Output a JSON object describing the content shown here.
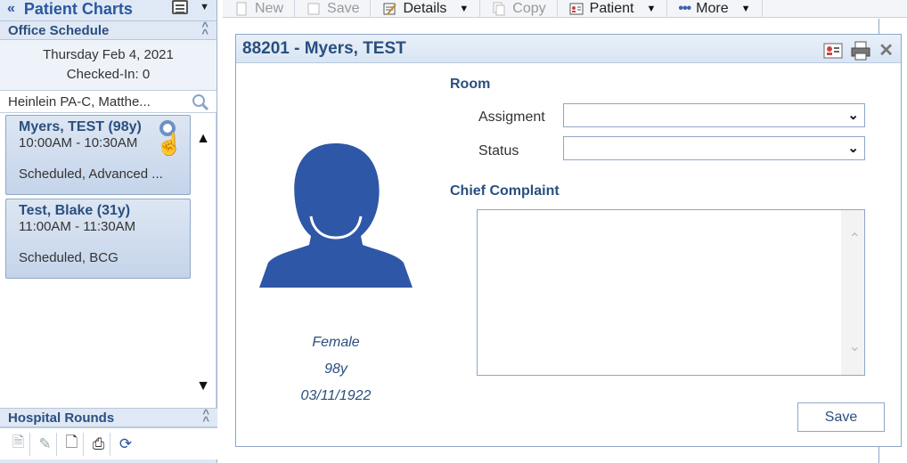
{
  "left": {
    "title": "Patient Charts",
    "collapse_icon": "double-chevron-left-icon",
    "office_schedule": {
      "label": "Office Schedule",
      "date": "Thursday Feb 4, 2021",
      "checked_in": "Checked-In: 0",
      "provider": "Heinlein PA-C, Matthe..."
    },
    "appointments": [
      {
        "name": "Myers, TEST (98y)",
        "time": "10:00AM - 10:30AM",
        "status": "Scheduled, Advanced ..."
      },
      {
        "name": "Test, Blake (31y)",
        "time": "11:00AM - 11:30AM",
        "status": "Scheduled, BCG"
      }
    ],
    "hospital_rounds": {
      "label": "Hospital Rounds"
    }
  },
  "toolbar": {
    "new": "New",
    "save": "Save",
    "details": "Details",
    "copy": "Copy",
    "patient": "Patient",
    "more": "More"
  },
  "dialog": {
    "title": "88201 - Myers, TEST",
    "patient": {
      "sex": "Female",
      "age": "98y",
      "dob": "03/11/1922"
    },
    "room_label": "Room",
    "assignment_label": "Assigment",
    "status_label": "Status",
    "assignment_value": "",
    "status_value": "",
    "chief_complaint_label": "Chief Complaint",
    "chief_complaint_value": "",
    "save_label": "Save"
  },
  "colors": {
    "accent": "#2a4f7e",
    "avatar": "#2f57a8",
    "panel": "#dfe9f5"
  }
}
